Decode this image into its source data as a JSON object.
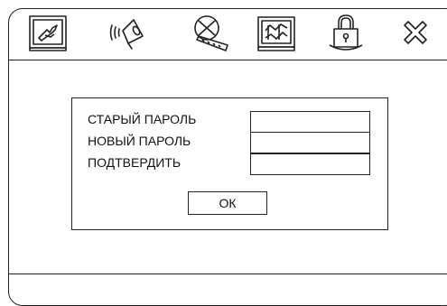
{
  "toolbar": {
    "icons": [
      "system-setup-icon",
      "audio-setup-icon",
      "video-setup-icon",
      "preference-setup-icon",
      "password-lock-icon",
      "exit-icon"
    ]
  },
  "password_dialog": {
    "old_password_label": "СТАРЫЙ ПАРОЛЬ",
    "new_password_label": "НОВЫЙ ПАРОЛЬ",
    "confirm_label": "ПОДТВЕРДИТЬ",
    "old_password_value": "",
    "new_password_value": "",
    "confirm_value": "",
    "ok_label": "ОК"
  }
}
